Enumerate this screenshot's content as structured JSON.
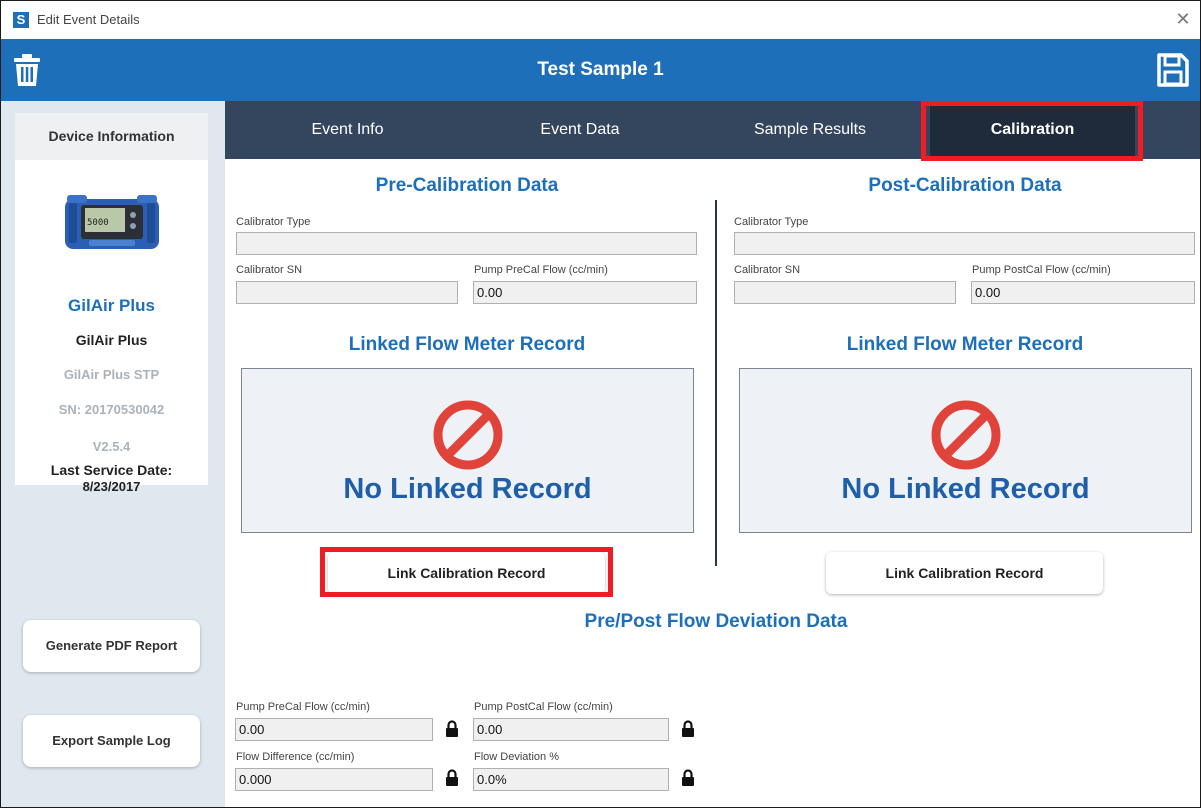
{
  "window": {
    "title": "Edit Event Details",
    "app_icon": "S",
    "close_glyph": "✕"
  },
  "header": {
    "title": "Test Sample 1",
    "delete_icon": "trash-icon",
    "save_icon": "save-icon"
  },
  "sidebar": {
    "device_panel_title": "Device Information",
    "device_image": "gilair-plus-pump",
    "device_name": "GilAir Plus",
    "model": "GilAir Plus",
    "sub_model": "GilAir Plus STP",
    "serial": "SN: 20170530042",
    "version": "V2.5.4",
    "last_service_label": "Last Service Date:",
    "last_service_date": "8/23/2017",
    "generate_pdf_label": "Generate PDF Report",
    "export_log_label": "Export Sample Log"
  },
  "tabs": [
    {
      "label": "Event Info",
      "active": false
    },
    {
      "label": "Event Data",
      "active": false
    },
    {
      "label": "Sample Results",
      "active": false
    },
    {
      "label": "Calibration",
      "active": true
    }
  ],
  "pre_cal": {
    "title": "Pre-Calibration Data",
    "calibrator_type_label": "Calibrator Type",
    "calibrator_type_value": "",
    "calibrator_sn_label": "Calibrator SN",
    "calibrator_sn_value": "",
    "flow_label": "Pump PreCal Flow (cc/min)",
    "flow_value": "0.00",
    "linked_title": "Linked Flow Meter Record",
    "no_record_text": "No Linked Record",
    "link_button_label": "Link Calibration Record"
  },
  "post_cal": {
    "title": "Post-Calibration Data",
    "calibrator_type_label": "Calibrator Type",
    "calibrator_type_value": "",
    "calibrator_sn_label": "Calibrator SN",
    "calibrator_sn_value": "",
    "flow_label": "Pump PostCal Flow (cc/min)",
    "flow_value": "0.00",
    "linked_title": "Linked Flow Meter Record",
    "no_record_text": "No Linked Record",
    "link_button_label": "Link Calibration Record"
  },
  "deviation": {
    "title": "Pre/Post Flow Deviation Data",
    "precal_label": "Pump PreCal Flow (cc/min)",
    "precal_value": "0.00",
    "postcal_label": "Pump PostCal Flow (cc/min)",
    "postcal_value": "0.00",
    "difference_label": "Flow Difference (cc/min)",
    "difference_value": "0.000",
    "percent_label": "Flow Deviation %",
    "percent_value": "0.0%"
  },
  "colors": {
    "header_blue": "#1e6fba",
    "tab_bar": "#34455e",
    "active_tab": "#1f2a3b",
    "highlight_red": "#ee1c24",
    "no_entry_red": "#e0433a"
  }
}
